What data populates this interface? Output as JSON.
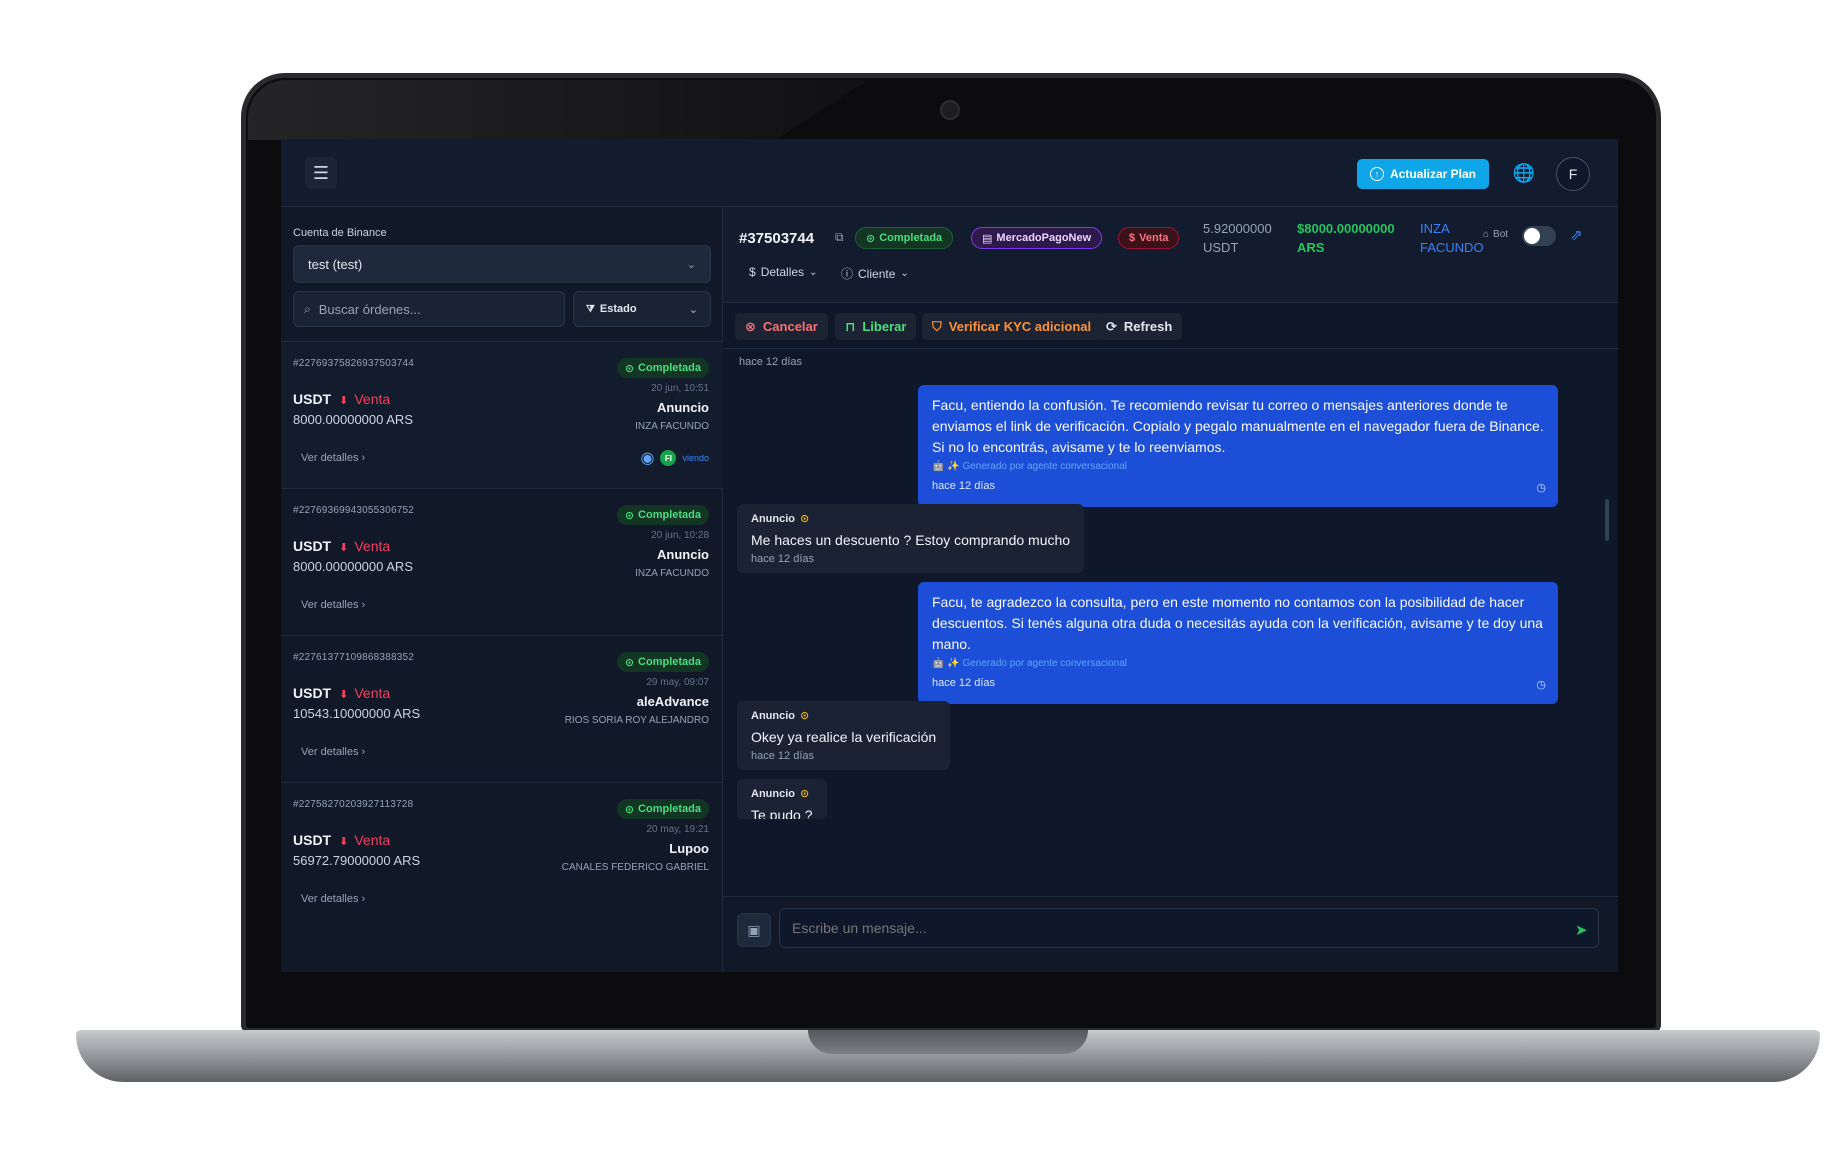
{
  "topbar": {
    "menu_icon": "hamburger-icon",
    "plan_button": "Actualizar Plan",
    "globe_icon": "globe-icon",
    "avatar_initial": "F"
  },
  "sidebar": {
    "account_label": "Cuenta de Binance",
    "account_value": "test (test)",
    "search_placeholder": "Buscar órdenes...",
    "status_filter": "Estado",
    "orders": [
      {
        "id": "#22769375826937503744",
        "status": "Completada",
        "date": "20 jun, 10:51",
        "asset": "USDT",
        "side": "Venta",
        "amount": "8000.00000000 ARS",
        "counterparty": "Anuncio",
        "legal_name": "INZA FACUNDO",
        "details": "Ver detalles",
        "watcher_initials": "FI",
        "watching_label": "viendo"
      },
      {
        "id": "#22769369943055306752",
        "status": "Completada",
        "date": "20 jun, 10:28",
        "asset": "USDT",
        "side": "Venta",
        "amount": "8000.00000000 ARS",
        "counterparty": "Anuncio",
        "legal_name": "INZA FACUNDO",
        "details": "Ver detalles"
      },
      {
        "id": "#22761377109868388352",
        "status": "Completada",
        "date": "29 may, 09:07",
        "asset": "USDT",
        "side": "Venta",
        "amount": "10543.10000000 ARS",
        "counterparty": "aleAdvance",
        "legal_name": "RIOS SORIA ROY ALEJANDRO",
        "details": "Ver detalles"
      },
      {
        "id": "#22758270203927113728",
        "status": "Completada",
        "date": "20 may, 19:21",
        "asset": "USDT",
        "side": "Venta",
        "amount": "56972.79000000 ARS",
        "counterparty": "Lupoo",
        "legal_name": "CANALES FEDERICO GABRIEL",
        "details": "Ver detalles"
      }
    ]
  },
  "order_header": {
    "number": "#37503744",
    "status": "Completada",
    "payment": "MercadoPagoNew",
    "side": "Venta",
    "qty_line1": "5.92000000",
    "qty_line2": "USDT",
    "total_line1": "$8000.00000000",
    "total_line2": "ARS",
    "cp_line1": "INZA",
    "cp_line2": "FACUNDO",
    "bot_label": "Bot",
    "bot_enabled": false,
    "details_label": "Detalles",
    "client_label": "Cliente"
  },
  "actions": {
    "cancel": "Cancelar",
    "release": "Liberar",
    "kyc": "Verificar KYC adicional",
    "refresh": "Refresh"
  },
  "chat": {
    "top_stamp": "hace 12 días",
    "messages": [
      {
        "direction": "out",
        "text": "Facu, entiendo la confusión. Te recomiendo revisar tu correo o mensajes anteriores donde te enviamos el link de verificación. Copialo y pegalo manualmente en el navegador fuera de Binance. Si no lo encontrás, avisame y te lo reenviamos.",
        "generated": "🤖 ✨ Generado por agente conversacional",
        "time": "hace 12 días"
      },
      {
        "direction": "in",
        "sender": "Anuncio",
        "text": "Me haces un descuento ? Estoy comprando mucho",
        "time": "hace 12 días"
      },
      {
        "direction": "out",
        "text": "Facu, te agradezco la consulta, pero en este momento no contamos con la posibilidad de hacer descuentos. Si tenés alguna otra duda o necesitás ayuda con la verificación, avisame y te doy una mano.",
        "generated": "🤖 ✨ Generado por agente conversacional",
        "time": "hace 12 días"
      },
      {
        "direction": "in",
        "sender": "Anuncio",
        "text": "Okey ya realice la verificación",
        "time": "hace 12 días"
      },
      {
        "direction": "in",
        "sender": "Anuncio",
        "text": "Te pudo ?",
        "time": ""
      }
    ]
  },
  "composer": {
    "placeholder": "Escribe un mensaje...",
    "image_icon": "image-icon",
    "send_icon": "send-icon"
  },
  "colors": {
    "accent": "#0ea5e9",
    "completed": "#4ade80",
    "sell": "#f43f5e",
    "outgoing_bubble": "#1d4ed8"
  }
}
